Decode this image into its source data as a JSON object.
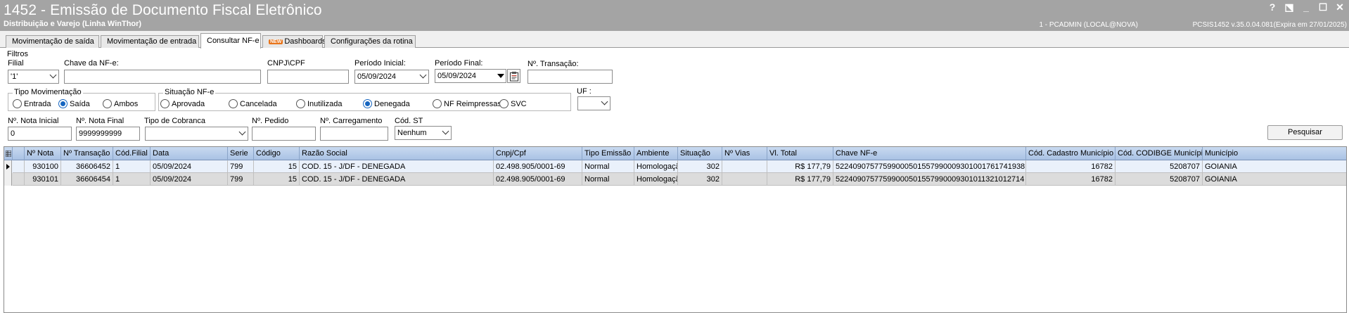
{
  "window": {
    "title": "1452 - Emissão de Documento Fiscal Eletrônico",
    "subtitle": "Distribuição e Varejo (Linha WinThor)",
    "session": "1 - PCADMIN (LOCAL@NOVA)",
    "version": "PCSIS1452  v.35.0.04.081(Expira em 27/01/2025)",
    "controls": [
      "?",
      "⬔",
      "_",
      "☐",
      "✕"
    ]
  },
  "tabs": [
    {
      "label": "Movimentação de saída",
      "active": false
    },
    {
      "label": "Movimentação de entrada",
      "active": false
    },
    {
      "label": "Consultar NF-e",
      "active": true
    },
    {
      "label": "Dashboards",
      "badge": "NEW",
      "active": false
    },
    {
      "label": "Configurações da rotina",
      "active": false
    }
  ],
  "filters": {
    "title": "Filtros",
    "filial": {
      "label": "Filial",
      "value": "'1'"
    },
    "chave": {
      "label": "Chave da NF-e:",
      "value": ""
    },
    "cnpj": {
      "label": "CNPJ\\CPF",
      "value": ""
    },
    "periodo_inicial": {
      "label": "Período Inicial:",
      "value": "05/09/2024"
    },
    "periodo_final": {
      "label": "Período Final:",
      "value": "05/09/2024"
    },
    "transacao": {
      "label": "Nº. Transação:",
      "value": ""
    },
    "tipo_movimentacao": {
      "label": "Tipo Movimentação",
      "options": [
        "Entrada",
        "Saída",
        "Ambos"
      ],
      "selected": "Saída"
    },
    "situacao": {
      "label": "Situação NF-e",
      "options": [
        "Aprovada",
        "Cancelada",
        "Inutilizada",
        "Denegada",
        "NF Reimpressas",
        "SVC"
      ],
      "selected": "Denegada"
    },
    "uf": {
      "label": "UF :",
      "value": ""
    },
    "nota_inicial": {
      "label": "Nº. Nota Inicial",
      "value": "0"
    },
    "nota_final": {
      "label": "Nº. Nota Final",
      "value": "9999999999"
    },
    "tipo_cobranca": {
      "label": "Tipo de Cobranca",
      "value": ""
    },
    "pedido": {
      "label": "Nº. Pedido",
      "value": ""
    },
    "carregamento": {
      "label": "Nº. Carregamento",
      "value": ""
    },
    "cod_st": {
      "label": "Cód. ST",
      "value": "Nenhum"
    },
    "search_button": "Pesquisar"
  },
  "grid": {
    "columns": [
      "Nº Nota",
      "Nº Transação",
      "Cód.Filial",
      "Data",
      "Serie",
      "Código",
      "Razão Social",
      "Cnpj/Cpf",
      "Tipo Emissão",
      "Ambiente",
      "Situação",
      "Nº Vias",
      "Vl. Total",
      "Chave NF-e",
      "Cód. Cadastro Município",
      "Cód. CODIBGE Município",
      "Município"
    ],
    "rows": [
      [
        "930100",
        "36606452",
        "1",
        "05/09/2024",
        "799",
        "15",
        "COD. 15 - J/DF - DENEGADA",
        "02.498.905/0001-69",
        "Normal",
        "Homologação",
        "302",
        "",
        "R$ 177,79",
        "52240907577599000501557990009301001761741938",
        "16782",
        "5208707",
        "GOIANIA"
      ],
      [
        "930101",
        "36606454",
        "1",
        "05/09/2024",
        "799",
        "15",
        "COD. 15 - J/DF - DENEGADA",
        "02.498.905/0001-69",
        "Normal",
        "Homologação",
        "302",
        "",
        "R$ 177,79",
        "52240907577599000501557990009301011321012714",
        "16782",
        "5208707",
        "GOIANIA"
      ]
    ]
  }
}
